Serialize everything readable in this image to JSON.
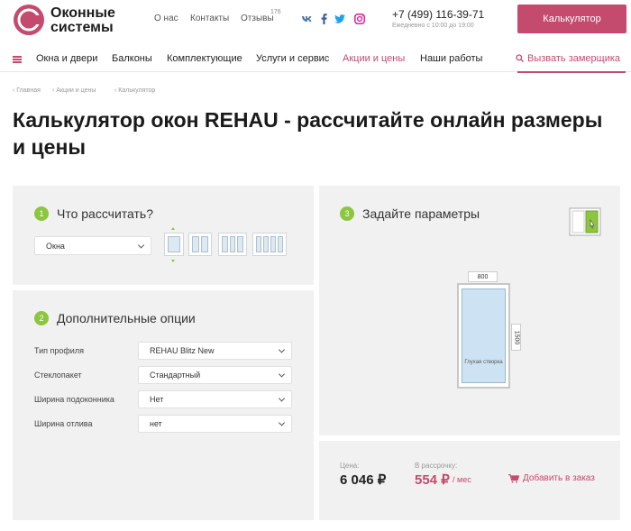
{
  "header": {
    "brand_line1": "Оконные",
    "brand_line2": "системы",
    "links": [
      "О нас",
      "Контакты",
      "Отзывы"
    ],
    "reviews_count": "176",
    "socials": [
      "vk-icon",
      "facebook-icon",
      "twitter-icon",
      "instagram-icon"
    ],
    "phone": "+7 (499) 116-39-71",
    "hours": "Ежедневно с 10:00 до 19:00",
    "calculator_button": "Калькулятор"
  },
  "nav": {
    "items": [
      "Окна и двери",
      "Балконы",
      "Комплектующие",
      "Услуги и сервис",
      "Акции и цены",
      "Наши работы"
    ],
    "active_item": "Акции и цены",
    "measure_link": "Вызвать замерщика"
  },
  "breadcrumb": [
    "Главная",
    "Акции и цены",
    "Калькулятор"
  ],
  "page_title": "Калькулятор окон REHAU - рассчитайте онлайн размеры и цены",
  "step1": {
    "number": "1",
    "title": "Что рассчитать?",
    "product_select": "Окна",
    "window_types": [
      "1-sash",
      "2-sash",
      "3-sash",
      "4-sash"
    ],
    "selected_type": "1-sash"
  },
  "step2": {
    "number": "2",
    "title": "Дополнительные опции",
    "options": [
      {
        "label": "Тип профиля",
        "value": "REHAU Blitz New"
      },
      {
        "label": "Стеклопакет",
        "value": "Стандартный"
      },
      {
        "label": "Ширина подоконника",
        "value": "Нет"
      },
      {
        "label": "Ширина отлива",
        "value": "нет"
      }
    ]
  },
  "step3": {
    "number": "3",
    "title": "Задайте параметры",
    "width": "800",
    "height": "1500",
    "sash_label": "Глухая створка"
  },
  "pricing": {
    "price_label": "Цена:",
    "price": "6 046 ₽",
    "installment_label": "В рассрочку:",
    "installment": "554 ₽",
    "per_month": "/ мес",
    "add_to_order": "Добавить в заказ"
  },
  "colors": {
    "accent": "#c44a6e",
    "step_badge": "#8cc63f",
    "panel_bg": "#f1f1f1"
  }
}
